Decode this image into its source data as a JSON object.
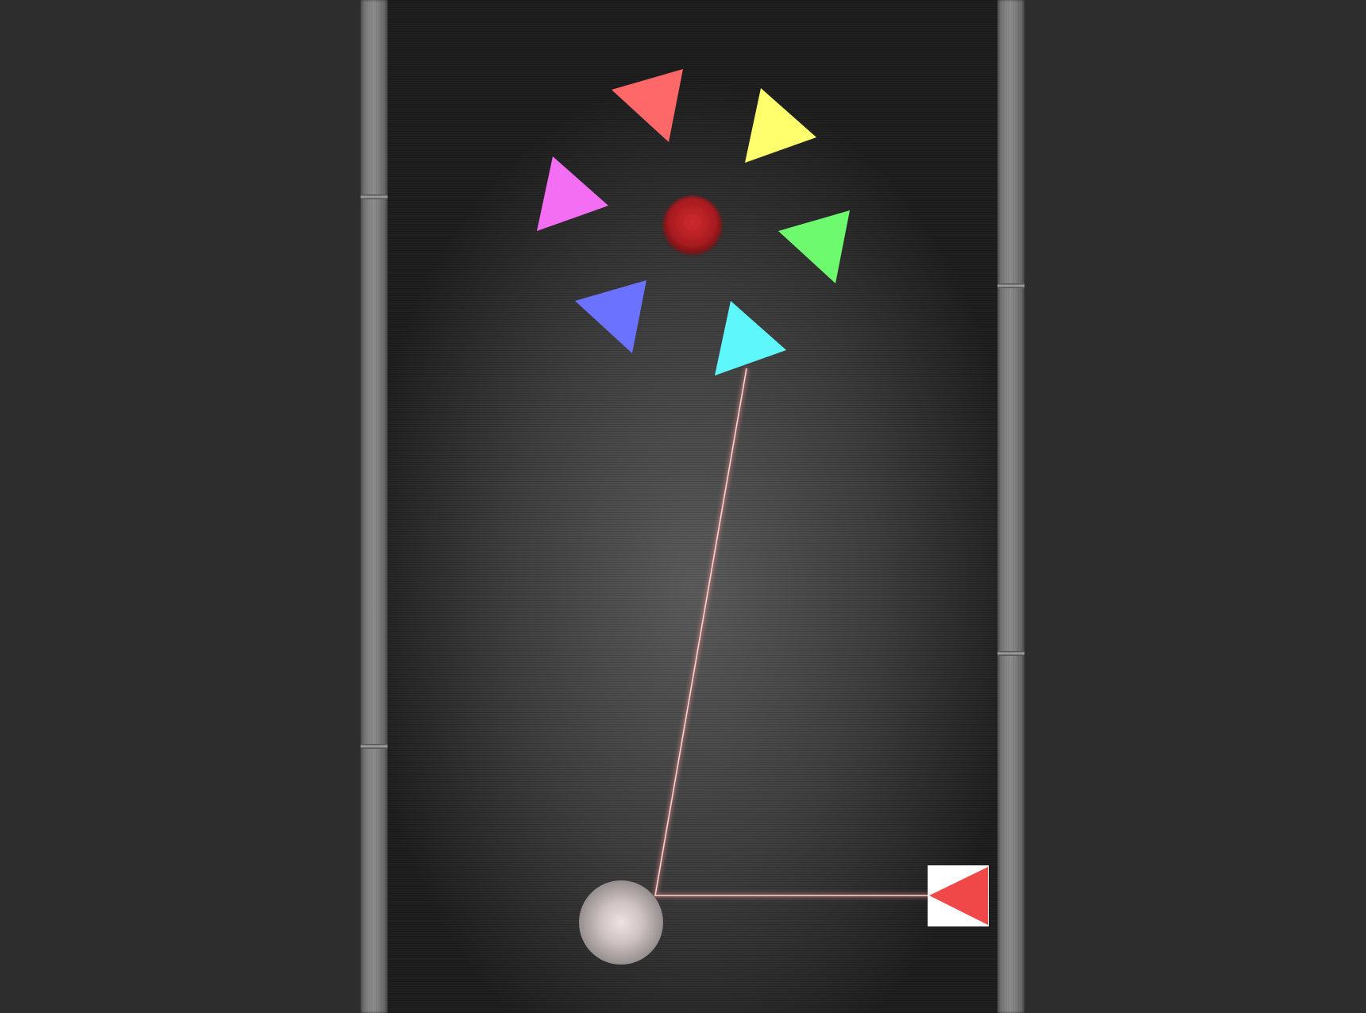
{
  "colors": {
    "background": "#2d2d2d",
    "laser": "#e8a0a0",
    "laser_core": "#ffd6d6",
    "target_dot": "#c0282c",
    "emitter_box": "#ffffff",
    "emitter_arrow": "#f04848"
  },
  "prisms": [
    {
      "name": "red-prism",
      "color": "#ff6868"
    },
    {
      "name": "yellow-prism",
      "color": "#ffff6e"
    },
    {
      "name": "magenta-prism",
      "color": "#f46ef4"
    },
    {
      "name": "green-prism",
      "color": "#6efa6e"
    },
    {
      "name": "blue-prism",
      "color": "#6a72ff"
    },
    {
      "name": "cyan-prism",
      "color": "#5ef8fc"
    }
  ],
  "icons": {
    "emitter": "laser-emitter-arrow-icon",
    "ball": "silver-ball-icon",
    "target": "red-target-dot-icon"
  }
}
